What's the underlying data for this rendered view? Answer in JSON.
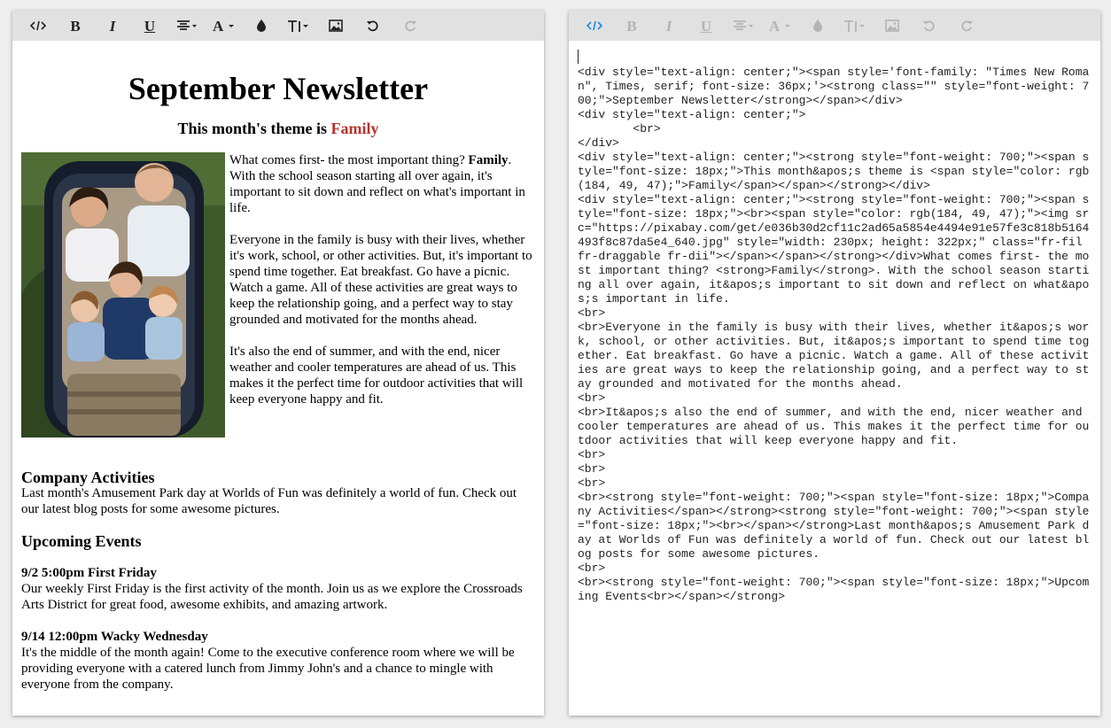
{
  "left_toolbar": {
    "buttons": [
      "code-view",
      "bold",
      "italic",
      "underline",
      "align",
      "font-family",
      "color",
      "font-size",
      "insert-image",
      "undo",
      "redo"
    ],
    "bold_glyph": "B",
    "italic_glyph": "I",
    "underline_glyph": "U"
  },
  "newsletter": {
    "title": "September Newsletter",
    "theme_prefix": "This month's theme is ",
    "theme_word": "Family",
    "image_alt": "Family of five smiling up from a convertible car",
    "p1_start": "What comes first- the most important thing? ",
    "p1_bold": "Family",
    "p1_rest": ". With the school season starting all over again, it's important to sit down and reflect on what's important in life.",
    "p2": "Everyone in the family is busy with their lives, whether it's work, school, or other activities. But, it's important to spend time together. Eat breakfast. Go have a picnic. Watch a game. All of these activities are great ways to keep the relationship going, and a perfect way to stay grounded and motivated for the months ahead.",
    "p3": "It's also the end of summer, and with the end, nicer weather and cooler temperatures are ahead of us. This makes it the perfect time for outdoor activities that will keep everyone happy and fit.",
    "company_heading": "Company Activities",
    "company_text": "Last month's Amusement Park day at Worlds of Fun was definitely a world of fun. Check out our latest blog posts for some awesome pictures.",
    "upcoming_heading": "Upcoming Events",
    "event1_title": "9/2 5:00pm First Friday",
    "event1_text": "Our weekly First Friday is the first activity of the month. Join us as we explore the Crossroads Arts District for great food, awesome exhibits, and amazing artwork.",
    "event2_title": "9/14 12:00pm Wacky Wednesday",
    "event2_text": "It's the middle of the month again! Come to the executive conference room where we will be providing everyone with a catered lunch from Jimmy John's and a chance to mingle with everyone from the company."
  },
  "right_toolbar": {
    "active": "code-view",
    "bold_glyph": "B",
    "italic_glyph": "I",
    "underline_glyph": "U"
  },
  "code_view": {
    "source": "<div style=\"text-align: center;\"><span style='font-family: \"Times New Roman\", Times, serif; font-size: 36px;'><strong class=\"\" style=\"font-weight: 700;\">September Newsletter</strong></span></div>\n<div style=\"text-align: center;\">\n        <br>\n</div>\n<div style=\"text-align: center;\"><strong style=\"font-weight: 700;\"><span style=\"font-size: 18px;\">This month&apos;s theme is <span style=\"color: rgb(184, 49, 47);\">Family</span></span></strong></div>\n<div style=\"text-align: center;\"><strong style=\"font-weight: 700;\"><span style=\"font-size: 18px;\"><br><span style=\"color: rgb(184, 49, 47);\"><img src=\"https://pixabay.com/get/e036b30d2cf11c2ad65a5854e4494e91e57fe3c818b5164493f8c87da5e4_640.jpg\" style=\"width: 230px; height: 322px;\" class=\"fr-fil fr-draggable fr-dii\"></span></span></strong></div>What comes first- the most important thing? <strong>Family</strong>. With the school season starting all over again, it&apos;s important to sit down and reflect on what&apos;s important in life.\n<br>\n<br>Everyone in the family is busy with their lives, whether it&apos;s work, school, or other activities. But, it&apos;s important to spend time together. Eat breakfast. Go have a picnic. Watch a game. All of these activities are great ways to keep the relationship going, and a perfect way to stay grounded and motivated for the months ahead.\n<br>\n<br>It&apos;s also the end of summer, and with the end, nicer weather and cooler temperatures are ahead of us. This makes it the perfect time for outdoor activities that will keep everyone happy and fit.\n<br>\n<br>\n<br>\n<br><strong style=\"font-weight: 700;\"><span style=\"font-size: 18px;\">Company Activities</span></strong><strong style=\"font-weight: 700;\"><span style=\"font-size: 18px;\"><br></span></strong>Last month&apos;s Amusement Park day at Worlds of Fun was definitely a world of fun. Check out our latest blog posts for some awesome pictures.\n<br>\n<br><strong style=\"font-weight: 700;\"><span style=\"font-size: 18px;\">Upcoming Events<br></span></strong>"
  }
}
